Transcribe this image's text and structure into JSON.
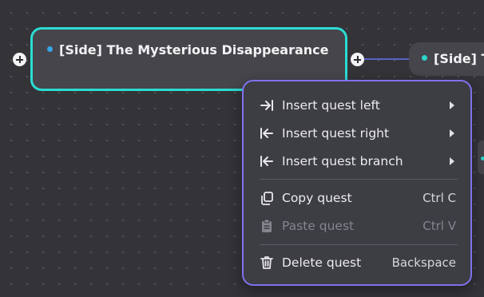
{
  "nodes": {
    "main_title": "[Side] The Mysterious Disappearance",
    "right_title": "[Side] The"
  },
  "context_menu": {
    "insert_left": "Insert quest left",
    "insert_right": "Insert quest right",
    "insert_branch": "Insert quest branch",
    "copy": "Copy quest",
    "copy_shortcut": "Ctrl C",
    "paste": "Paste quest",
    "paste_shortcut": "Ctrl V",
    "delete": "Delete quest",
    "delete_shortcut": "Backspace"
  },
  "icons": [
    "insert-left-icon",
    "insert-right-icon",
    "insert-branch-icon",
    "copy-icon",
    "clipboard-icon",
    "trash-icon",
    "plus-icon",
    "submenu-arrow-icon"
  ],
  "colors": {
    "canvas": "#333338",
    "node": "#45454b",
    "selected_border": "#2bdcd2",
    "menu_border": "#7e72ee",
    "connector": "#5a63c9",
    "dot_blue": "#3aa6e8",
    "dot_teal": "#2bd3c8"
  }
}
